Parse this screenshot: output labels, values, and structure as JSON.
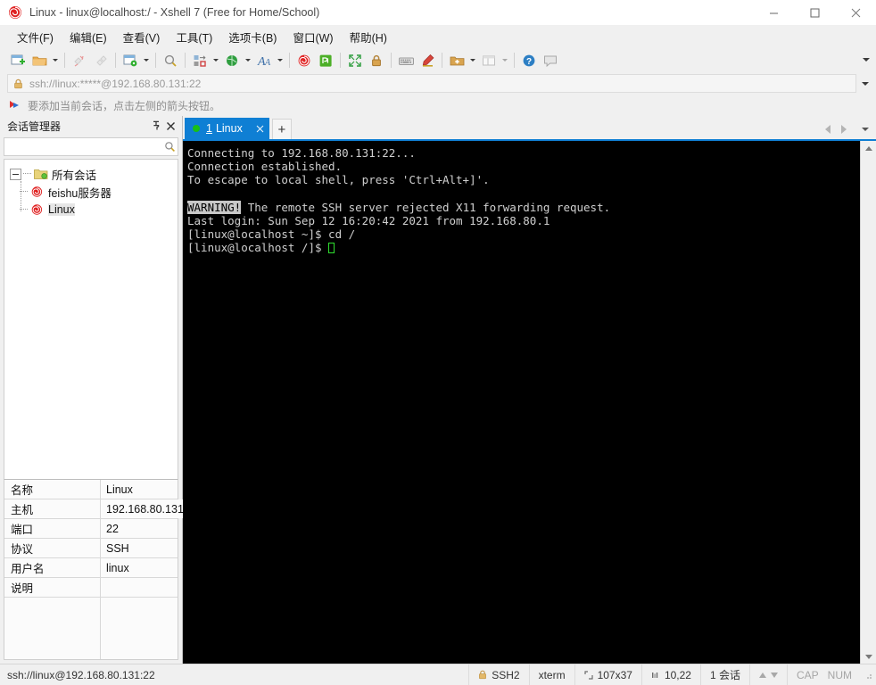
{
  "window": {
    "title": "Linux - linux@localhost:/ - Xshell 7 (Free for Home/School)",
    "app_icon": "xshell-logo-icon",
    "minimize_label": "—",
    "maximize_label": "☐",
    "close_label": "✕"
  },
  "menu": {
    "items": [
      {
        "label": "文件(F)",
        "name": "menu-file"
      },
      {
        "label": "编辑(E)",
        "name": "menu-edit"
      },
      {
        "label": "查看(V)",
        "name": "menu-view"
      },
      {
        "label": "工具(T)",
        "name": "menu-tools"
      },
      {
        "label": "选项卡(B)",
        "name": "menu-tabs"
      },
      {
        "label": "窗口(W)",
        "name": "menu-window"
      },
      {
        "label": "帮助(H)",
        "name": "menu-help"
      }
    ]
  },
  "toolbar": {
    "icons": [
      "new-session-icon",
      "open-folder-icon",
      "disconnect-icon",
      "reconnect-icon",
      "session-properties-icon",
      "find-icon",
      "transfer-icon",
      "globe-icon",
      "font-icon",
      "xshell-icon",
      "xftp-icon",
      "fullscreen-icon",
      "lock-icon",
      "keyboard-icon",
      "highlight-icon",
      "add-folder-icon",
      "layout-icon",
      "help-icon",
      "comment-icon"
    ],
    "overflow": "toolbar-overflow-icon"
  },
  "address": {
    "lock_icon": "lock-icon",
    "value": "ssh://linux:*****@192.168.80.131:22",
    "placeholder": "ssh://",
    "dropdown": "address-dropdown-icon"
  },
  "hint": {
    "icon": "add-session-arrow-icon",
    "text": "要添加当前会话，点击左侧的箭头按钮。"
  },
  "session_manager": {
    "title": "会话管理器",
    "pin_label": "⚐",
    "close_label": "✕",
    "search_value": "",
    "search_placeholder": "",
    "tree": {
      "root": {
        "label": "所有会话",
        "icon": "folder-sessions-icon"
      },
      "children": [
        {
          "label": "feishu服务器",
          "icon": "xshell-session-icon",
          "selected": false
        },
        {
          "label": "Linux",
          "icon": "xshell-session-icon",
          "selected": true
        }
      ]
    }
  },
  "properties": {
    "rows": [
      {
        "key": "名称",
        "value": "Linux"
      },
      {
        "key": "主机",
        "value": "192.168.80.131"
      },
      {
        "key": "端口",
        "value": "22"
      },
      {
        "key": "协议",
        "value": "SSH"
      },
      {
        "key": "用户名",
        "value": "linux"
      },
      {
        "key": "说明",
        "value": ""
      }
    ]
  },
  "tabs": {
    "items": [
      {
        "number": "1",
        "label": "Linux",
        "status_icon": "connected-dot-icon",
        "close_label": "✕",
        "active": true
      }
    ],
    "new_tab_label": "+",
    "prev_label": "prev-tab-icon",
    "next_label": "next-tab-icon",
    "list_label": "tab-list-icon"
  },
  "terminal": {
    "lines": [
      {
        "text": "Connecting to 192.168.80.131:22..."
      },
      {
        "text": "Connection established."
      },
      {
        "text": "To escape to local shell, press 'Ctrl+Alt+]'."
      },
      {
        "text": ""
      },
      {
        "segments": [
          {
            "text": "WARNING!",
            "style": "inverse"
          },
          {
            "text": " The remote SSH server rejected X11 forwarding request.",
            "style": "normal"
          }
        ]
      },
      {
        "text": "Last login: Sun Sep 12 16:20:42 2021 from 192.168.80.1"
      },
      {
        "text": "[linux@localhost ~]$ cd /"
      },
      {
        "segments": [
          {
            "text": "[linux@localhost /]$ ",
            "style": "normal"
          },
          {
            "text": "",
            "style": "cursor"
          }
        ]
      }
    ],
    "scrollbar": {
      "up_icon": "scroll-up-icon",
      "down_icon": "scroll-down-icon"
    }
  },
  "statusbar": {
    "connection": "ssh://linux@192.168.80.131:22",
    "security_icon": "lock-icon",
    "protocol": "SSH2",
    "terminal_type": "xterm",
    "size_icon": "terminal-size-icon",
    "size": "107x37",
    "cursor_icon": "cursor-position-icon",
    "cursor_position": "10,22",
    "sessions": "1 会话",
    "up_icon": "transfer-up-icon",
    "down_icon": "transfer-down-icon",
    "caps": "CAP",
    "num": "NUM",
    "grip": "resize-grip-icon"
  },
  "colors": {
    "accent": "#0f7fd4",
    "chrome": "#f0f0f0",
    "terminal_bg": "#000000",
    "terminal_fg": "#cfcfcf",
    "cursor": "#2fdf2f",
    "connected": "#18c018"
  }
}
